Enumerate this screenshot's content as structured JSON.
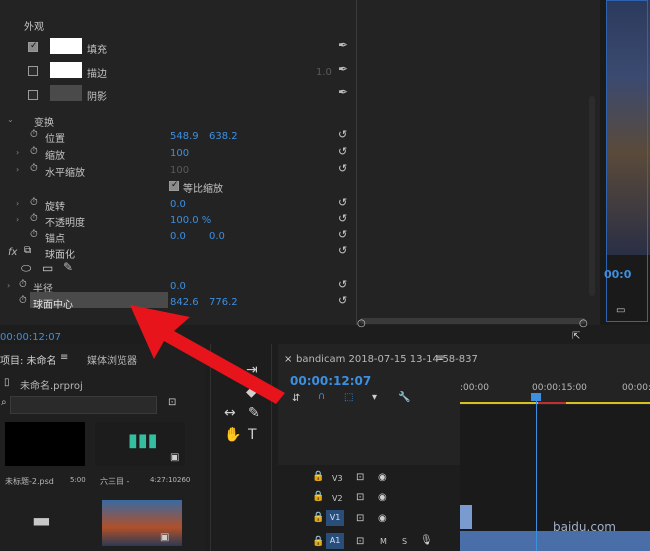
{
  "effect_controls": {
    "appearance_header": "外观",
    "fill_label": "填充",
    "stroke_label": "描边",
    "stroke_value": "1.0",
    "shadow_label": "阴影",
    "transform_header": "变换",
    "position_label": "位置",
    "position_x": "548.9",
    "position_y": "638.2",
    "scale_label": "缩放",
    "scale_value": "100",
    "scale_width_label": "水平缩放",
    "scale_width_value": "100",
    "uniform_scale_label": "等比缩放",
    "rotation_label": "旋转",
    "rotation_value": "0.0",
    "opacity_label": "不透明度",
    "opacity_value": "100.0 %",
    "anchor_label": "锚点",
    "anchor_x": "0.0",
    "anchor_y": "0.0",
    "fx_label": "fx",
    "spherize_label": "球面化",
    "radius_label": "半径",
    "radius_value": "0.0",
    "sphere_center_label": "球面中心",
    "sphere_center_x": "842.6",
    "sphere_center_y": "776.2",
    "timecode": "00:00:12:07"
  },
  "program_monitor": {
    "timecode": "00:0"
  },
  "project_panel": {
    "tab_project": "项目: 未命名",
    "tab_media_browser": "媒体浏览器",
    "file_name": "未命名.prproj",
    "items": [
      {
        "name": "未标题-2.psd",
        "duration": "5:00"
      },
      {
        "name": "六三目 -",
        "duration": "4:27:10260"
      }
    ]
  },
  "timeline": {
    "sequence_name": "bandicam 2018-07-15 13-14-58-837",
    "timecode": "00:00:12:07",
    "ruler_start": ":00:00",
    "ruler_mid": "00:00:15:00",
    "ruler_end": "00:00:3",
    "tracks": [
      "V3",
      "V2",
      "V1",
      "A1"
    ],
    "a1_m": "M",
    "a1_s": "S",
    "watermark": "baidu.com"
  },
  "colors": {
    "accent_blue": "#3d8fe0",
    "annotation_red": "#e8141c"
  }
}
